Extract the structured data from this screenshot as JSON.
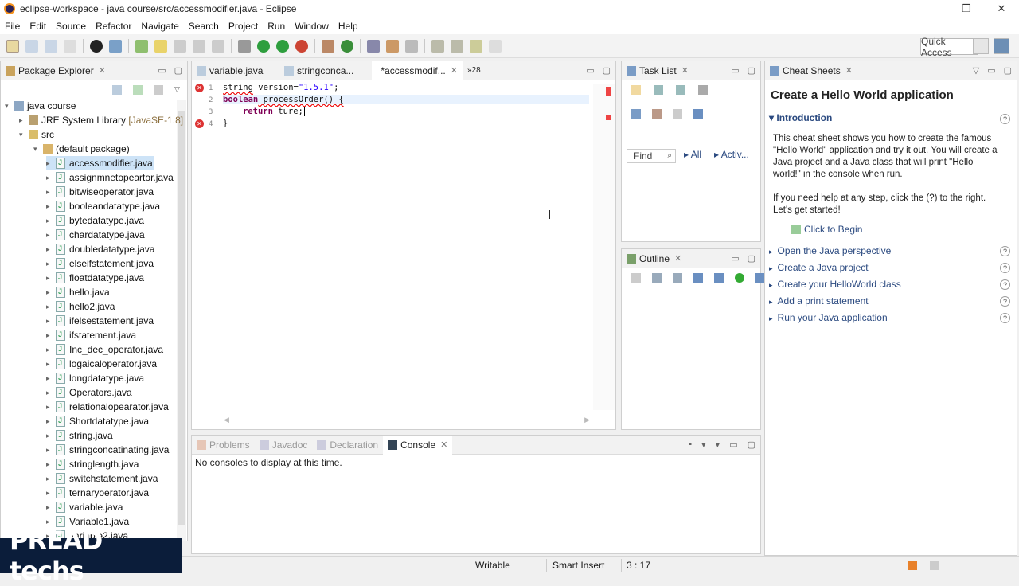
{
  "window": {
    "title": "eclipse-workspace - java course/src/accessmodifier.java - Eclipse",
    "minimize": "–",
    "restore": "❐",
    "close": "✕"
  },
  "menu": [
    "File",
    "Edit",
    "Source",
    "Refactor",
    "Navigate",
    "Search",
    "Project",
    "Run",
    "Window",
    "Help"
  ],
  "toolbar": {
    "quick_access": "Quick Access"
  },
  "package_explorer": {
    "title": "Package Explorer",
    "project": "java course",
    "jre": "JRE System Library",
    "jre_version": "[JavaSE-1.8]",
    "src": "src",
    "package": "(default package)",
    "files": [
      "accessmodifier.java",
      "assignmnetopeartor.java",
      "bitwiseoperator.java",
      "booleandatatype.java",
      "bytedatatype.java",
      "chardatatype.java",
      "doubledatatype.java",
      "elseifstatement.java",
      "floatdatatype.java",
      "hello.java",
      "hello2.java",
      "ifelsestatement.java",
      "ifstatement.java",
      "Inc_dec_operator.java",
      "logaicaloperator.java",
      "longdatatype.java",
      "Operators.java",
      "relationalopearator.java",
      "Shortdatatype.java",
      "string.java",
      "stringconcatinating.java",
      "stringlength.java",
      "switchstatement.java",
      "ternaryoerator.java",
      "variable.java",
      "Variable1.java",
      "variable2.java"
    ]
  },
  "editor": {
    "tabs": [
      "variable.java",
      "stringconca...",
      "*accessmodif...",
      "»28"
    ],
    "line_numbers": [
      "1",
      "2",
      "3",
      "4"
    ],
    "line1": {
      "type": "string",
      "rest": " version=",
      "value": "\"1.5.1\"",
      "end": ";"
    },
    "line2": {
      "type": "boolean",
      "rest": " processOrder() {"
    },
    "line3": {
      "kw": "return",
      "rest": " ture;"
    },
    "line4": "}"
  },
  "task_list": {
    "title": "Task List",
    "find": "Find",
    "all": "All",
    "activ": "Activ..."
  },
  "outline": {
    "title": "Outline"
  },
  "cheat_sheets": {
    "title": "Cheat Sheets",
    "heading": "Create a Hello World application",
    "intro": "Introduction",
    "p1": "This cheat sheet shows you how to create the famous \"Hello World\" application and try it out. You will create a Java project and a Java class that will print \"Hello world!\" in the console when run.",
    "p2": "If you need help at any step, click the (?) to the right. Let's get started!",
    "begin": "Click to Begin",
    "steps": [
      "Open the Java perspective",
      "Create a Java project",
      "Create your HelloWorld class",
      "Add a print statement",
      "Run your Java application"
    ]
  },
  "bottom": {
    "tabs": [
      "Problems",
      "Javadoc",
      "Declaration",
      "Console"
    ],
    "message": "No consoles to display at this time."
  },
  "status": {
    "writable": "Writable",
    "insert": "Smart Insert",
    "position": "3 : 17"
  },
  "logo": {
    "text": "PREAD techs"
  }
}
